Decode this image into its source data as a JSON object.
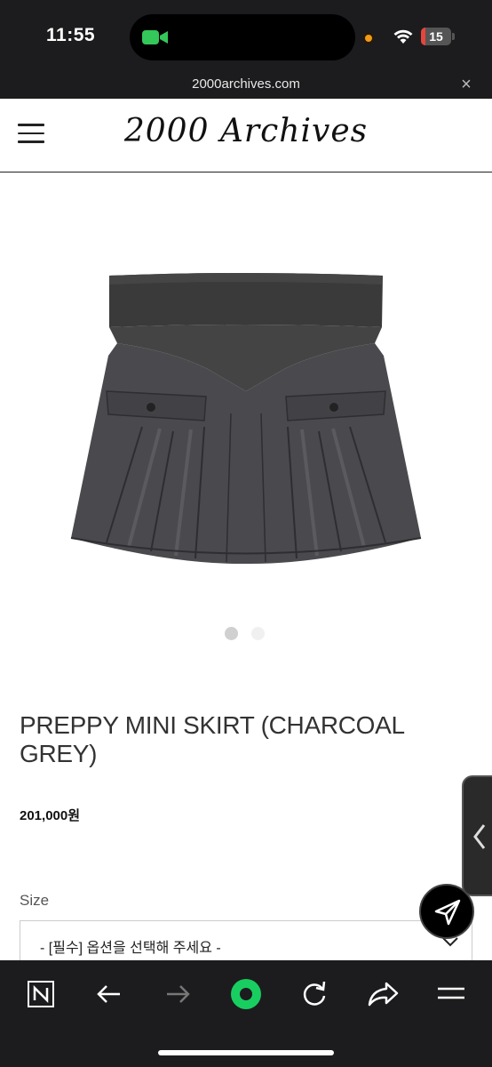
{
  "status_bar": {
    "time": "11:55",
    "battery": "15",
    "battery_level": 0.15,
    "icons": [
      "facetime-icon",
      "privacy-dot-icon",
      "wifi-icon",
      "battery-icon"
    ]
  },
  "url_bar": {
    "url": "2000archives.com",
    "close_glyph": "×"
  },
  "header": {
    "logo": "2000 Archives",
    "menu_icon": "hamburger-menu-icon"
  },
  "product": {
    "image_icon": "pleated-mini-skirt-image",
    "carousel": {
      "count": 2,
      "active": 0,
      "active_color": "#d0d0d0",
      "inactive_color": "#f0f0f0"
    },
    "title": "PREPPY MINI SKIRT (CHARCOAL GREY)",
    "price": "201,000원",
    "size_label": "Size",
    "size_select_value": "- [필수] 옵션을 선택해 주세요 -"
  },
  "floating": {
    "share_icon": "paper-plane-icon",
    "side_handle_icon": "chevron-left-icon"
  },
  "toolbar": {
    "items": [
      {
        "name": "naver-n-icon"
      },
      {
        "name": "back-arrow-icon"
      },
      {
        "name": "forward-arrow-icon"
      },
      {
        "name": "green-home-circle-icon"
      },
      {
        "name": "reload-icon"
      },
      {
        "name": "share-arrow-icon"
      },
      {
        "name": "menu-icon"
      }
    ],
    "accent": "#19ce60"
  }
}
